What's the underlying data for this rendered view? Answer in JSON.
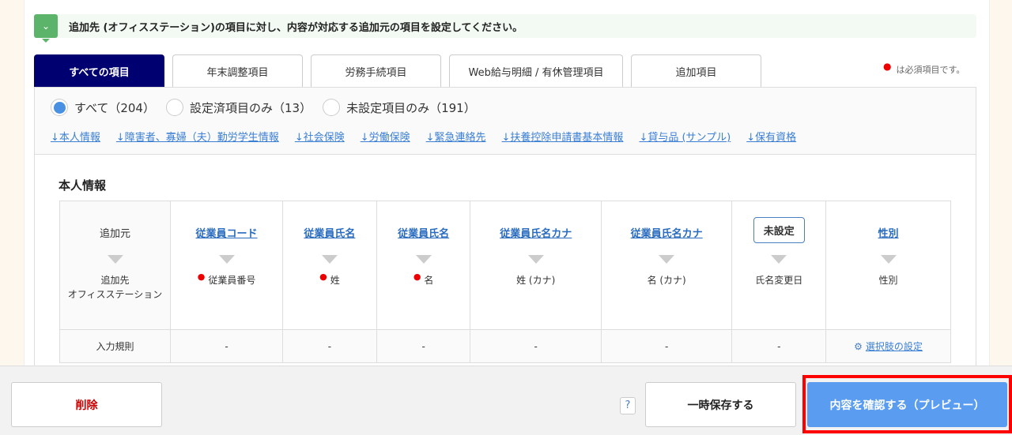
{
  "notice": "追加先 (オフィスステーション)の項目に対し、内容が対応する追加元の項目を設定してください。",
  "tabs": [
    "すべての項目",
    "年末調整項目",
    "労務手続項目",
    "Web給与明細 / 有休管理項目",
    "追加項目"
  ],
  "required_note": "は必須項目です。",
  "radios": [
    "すべて（204）",
    "設定済項目のみ（13）",
    "未設定項目のみ（191）"
  ],
  "links": [
    "↓本人情報",
    "↓障害者、寡婦（夫）勤労学生情報",
    "↓社会保険",
    "↓労働保険",
    "↓緊急連絡先",
    "↓扶養控除申請書基本情報",
    "↓貸与品 (サンプル)",
    "↓保有資格"
  ],
  "section_title": "本人情報",
  "row_labels": {
    "source": "追加元",
    "dest": "追加先\nオフィスステーション",
    "rule": "入力規則"
  },
  "columns": [
    {
      "source": "従業員コード",
      "dest": "従業員番号",
      "required": true,
      "rule": "-"
    },
    {
      "source": "従業員氏名",
      "dest": "姓",
      "required": true,
      "rule": "-"
    },
    {
      "source": "従業員氏名",
      "dest": "名",
      "required": true,
      "rule": "-"
    },
    {
      "source": "従業員氏名カナ",
      "dest": "姓 (カナ)",
      "required": false,
      "rule": "-"
    },
    {
      "source": "従業員氏名カナ",
      "dest": "名 (カナ)",
      "required": false,
      "rule": "-"
    },
    {
      "source": "未設定",
      "dest": "氏名変更日",
      "required": false,
      "rule": "-",
      "unset": true
    },
    {
      "source": "性別",
      "dest": "性別",
      "required": false,
      "rule": "選択肢の設定",
      "rule_link": true
    }
  ],
  "footer": {
    "delete": "削除",
    "help": "?",
    "save": "一時保存する",
    "preview": "内容を確認する（プレビュー）"
  }
}
